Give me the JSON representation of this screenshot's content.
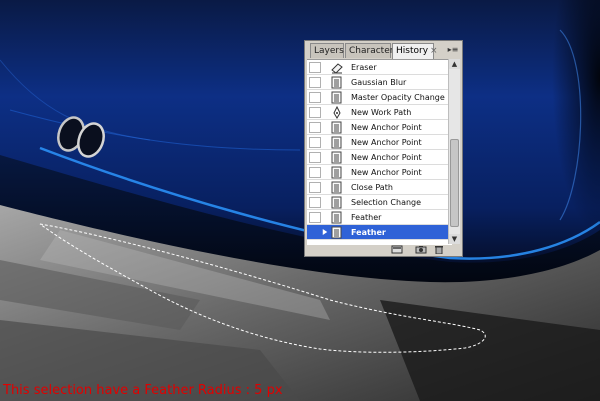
{
  "panel": {
    "tabs": {
      "layers": "Layers",
      "character": "Character",
      "history": "History"
    },
    "close_glyph": "×",
    "menu_glyph": "▸≡",
    "items": [
      {
        "label": "Eraser",
        "icon": "eraser-icon"
      },
      {
        "label": "Gaussian Blur",
        "icon": "history-state-icon"
      },
      {
        "label": "Master Opacity Change",
        "icon": "history-state-icon"
      },
      {
        "label": "New Work Path",
        "icon": "pen-icon"
      },
      {
        "label": "New Anchor Point",
        "icon": "history-state-icon"
      },
      {
        "label": "New Anchor Point",
        "icon": "history-state-icon"
      },
      {
        "label": "New Anchor Point",
        "icon": "history-state-icon"
      },
      {
        "label": "New Anchor Point",
        "icon": "history-state-icon"
      },
      {
        "label": "Close Path",
        "icon": "history-state-icon"
      },
      {
        "label": "Selection Change",
        "icon": "history-state-icon"
      },
      {
        "label": "Feather",
        "icon": "history-state-icon"
      },
      {
        "label": "Feather",
        "icon": "history-state-icon",
        "selected": true
      }
    ],
    "scroll_up": "▲",
    "scroll_down": "▼"
  },
  "caption": "This selection have a Feather Radius : 5 px",
  "colors": {
    "selection": "#2f62d7",
    "caption": "#e10000",
    "car_blue": "#0b2f8a"
  }
}
